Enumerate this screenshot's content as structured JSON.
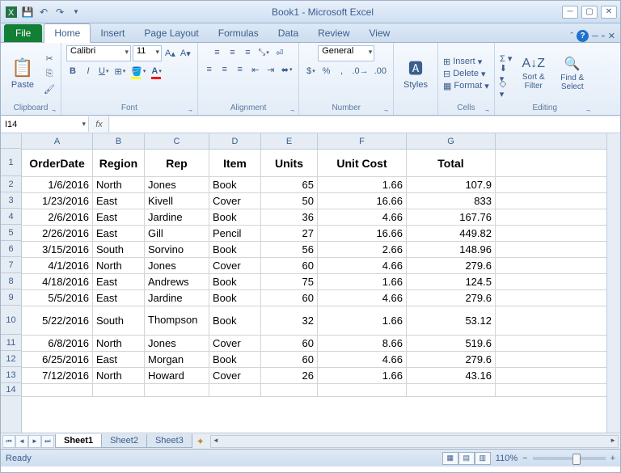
{
  "window": {
    "title": "Book1 - Microsoft Excel"
  },
  "tabs": {
    "file": "File",
    "list": [
      "Home",
      "Insert",
      "Page Layout",
      "Formulas",
      "Data",
      "Review",
      "View"
    ],
    "active": "Home"
  },
  "ribbon": {
    "clipboard": {
      "label": "Clipboard",
      "paste": "Paste"
    },
    "font": {
      "label": "Font",
      "name": "Calibri",
      "size": "11"
    },
    "alignment": {
      "label": "Alignment"
    },
    "number": {
      "label": "Number",
      "format": "General"
    },
    "styles": {
      "label": "Styles",
      "btn": "Styles"
    },
    "cells": {
      "label": "Cells",
      "insert": "Insert",
      "delete": "Delete",
      "format": "Format"
    },
    "editing": {
      "label": "Editing",
      "sort": "Sort & Filter",
      "find": "Find & Select"
    }
  },
  "formula": {
    "namebox": "I14",
    "fx": "fx",
    "value": ""
  },
  "columns": [
    "A",
    "B",
    "C",
    "D",
    "E",
    "F",
    "G"
  ],
  "headers": [
    "OrderDate",
    "Region",
    "Rep",
    "Item",
    "Units",
    "Unit Cost",
    "Total"
  ],
  "rows": [
    {
      "n": 2,
      "d": [
        "1/6/2016",
        "North",
        "Jones",
        "Book",
        "65",
        "1.66",
        "107.9"
      ]
    },
    {
      "n": 3,
      "d": [
        "1/23/2016",
        "East",
        "Kivell",
        "Cover",
        "50",
        "16.66",
        "833"
      ]
    },
    {
      "n": 4,
      "d": [
        "2/6/2016",
        "East",
        "Jardine",
        "Book",
        "36",
        "4.66",
        "167.76"
      ]
    },
    {
      "n": 5,
      "d": [
        "2/26/2016",
        "East",
        "Gill",
        "Pencil",
        "27",
        "16.66",
        "449.82"
      ]
    },
    {
      "n": 6,
      "d": [
        "3/15/2016",
        "South",
        "Sorvino",
        "Book",
        "56",
        "2.66",
        "148.96"
      ]
    },
    {
      "n": 7,
      "d": [
        "4/1/2016",
        "North",
        "Jones",
        "Cover",
        "60",
        "4.66",
        "279.6"
      ]
    },
    {
      "n": 8,
      "d": [
        "4/18/2016",
        "East",
        "Andrews",
        "Book",
        "75",
        "1.66",
        "124.5"
      ]
    },
    {
      "n": 9,
      "d": [
        "5/5/2016",
        "East",
        "Jardine",
        "Book",
        "60",
        "4.66",
        "279.6"
      ]
    },
    {
      "n": 10,
      "d": [
        "5/22/2016",
        "South",
        "Thompson",
        "Book",
        "32",
        "1.66",
        "53.12"
      ],
      "tall": true
    },
    {
      "n": 11,
      "d": [
        "6/8/2016",
        "North",
        "Jones",
        "Cover",
        "60",
        "8.66",
        "519.6"
      ]
    },
    {
      "n": 12,
      "d": [
        "6/25/2016",
        "East",
        "Morgan",
        "Book",
        "60",
        "4.66",
        "279.6"
      ]
    },
    {
      "n": 13,
      "d": [
        "7/12/2016",
        "North",
        "Howard",
        "Cover",
        "26",
        "1.66",
        "43.16"
      ]
    }
  ],
  "sheets": {
    "active": "Sheet1",
    "others": [
      "Sheet2",
      "Sheet3"
    ]
  },
  "status": {
    "ready": "Ready",
    "zoom": "110%"
  }
}
